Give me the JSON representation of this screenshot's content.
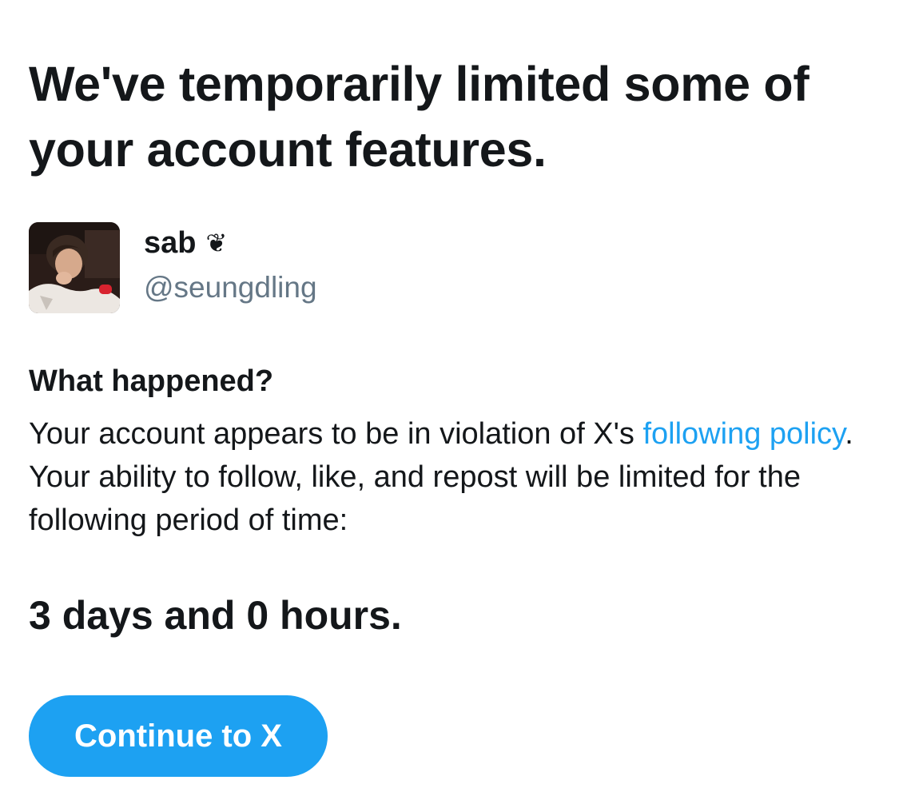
{
  "heading": "We've temporarily limited some of your account features.",
  "profile": {
    "name": "sab",
    "name_emoji": "❦",
    "handle": "@seungdling",
    "avatar_icon": "user-photo"
  },
  "section": {
    "title": "What happened?",
    "body_before_link": "Your account appears to be in violation of X's ",
    "link_text": "following policy",
    "body_after_link": ". Your ability to follow, like, and repost will be limited for the following period of time:"
  },
  "duration": "3 days and 0 hours.",
  "button": {
    "label": "Continue to X"
  },
  "colors": {
    "accent": "#1da1f2",
    "text": "#14171a",
    "secondary": "#657786",
    "background": "#ffffff"
  }
}
